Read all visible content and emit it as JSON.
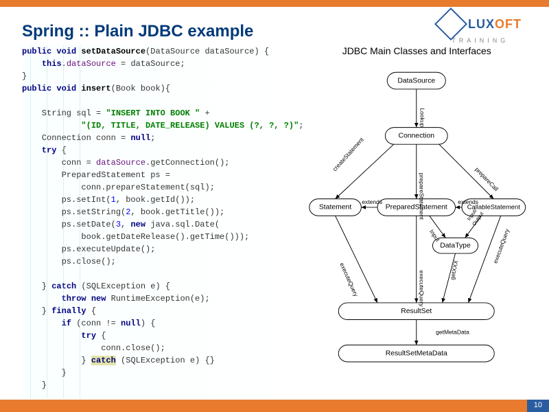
{
  "title": "Spring :: Plain JDBC example",
  "logo": {
    "main": "LUXOFT",
    "sub": "TRAINING"
  },
  "code": {
    "l1_kw": "public void",
    "l1_name": " setDataSource",
    "l1_rest": "(DataSource dataSource) {",
    "l2_kw": "this",
    "l2a": ".",
    "l2_field": "dataSource",
    "l2b": " = dataSource;",
    "l3": "}",
    "l4_kw": "public void",
    "l4_name": " insert",
    "l4_rest": "(Book book){",
    "l5": "",
    "l6a": "    String sql = ",
    "l6_str": "\"INSERT INTO BOOK \"",
    "l6b": " +",
    "l7a": "            ",
    "l7_str": "\"(ID, TITLE, DATE_RELEASE) VALUES (?, ?, ?)\"",
    "l7b": ";",
    "l8a": "    Connection conn = ",
    "l8_kw": "null",
    "l8b": ";",
    "l9_kw": "    try",
    "l9a": " {",
    "l10a": "        conn = ",
    "l10_field": "dataSource",
    "l10b": ".getConnection();",
    "l11": "        PreparedStatement ps =",
    "l12": "            conn.prepareStatement(sql);",
    "l13a": "        ps.setInt(",
    "l13_n": "1",
    "l13b": ", book.getId());",
    "l14a": "        ps.setString(",
    "l14_n": "2",
    "l14b": ", book.getTitle());",
    "l15a": "        ps.setDate(",
    "l15_n": "3",
    "l15b": ", ",
    "l15_kw": "new",
    "l15c": " java.sql.Date(",
    "l16": "            book.getDateRelease().getTime()));",
    "l17": "        ps.executeUpdate();",
    "l18": "        ps.close();",
    "l19": "",
    "l20a": "    } ",
    "l20_kw": "catch",
    "l20b": " (SQLException e) {",
    "l21_kw": "        throw new",
    "l21a": " RuntimeException(e);",
    "l22a": "    } ",
    "l22_kw": "finally",
    "l22b": " {",
    "l23_kw": "        if",
    "l23a": " (conn != ",
    "l23_kw2": "null",
    "l23b": ") {",
    "l24_kw": "            try",
    "l24a": " {",
    "l25": "                conn.close();",
    "l26a": "            } ",
    "l26_kw": "catch",
    "l26b": " (SQLException e) {}",
    "l27": "        }",
    "l28": "    }"
  },
  "diagram": {
    "title": "JDBC Main Classes and Interfaces",
    "nodes": {
      "ds": "DataSource",
      "conn": "Connection",
      "stmt": "Statement",
      "pstmt": "PreparedStatement",
      "cstmt": "CallableStatement",
      "dtype": "DataType",
      "rs": "ResultSet",
      "rsmd": "ResultSetMetaData"
    },
    "edges": {
      "lookup": "Lookup",
      "createStmt": "createStatement",
      "prepStmt": "prepareStatement",
      "prepCall": "prepareCall",
      "extends1": "extends",
      "extends2": "extends",
      "execQ1": "executeQuery",
      "execQ2": "executeQuery",
      "execQ3": "executeQuery",
      "input": "Input",
      "inout": "Input/\nOutput",
      "getXXX": "getXXX",
      "getMeta": "getMetaData"
    }
  },
  "pageNumber": "10"
}
